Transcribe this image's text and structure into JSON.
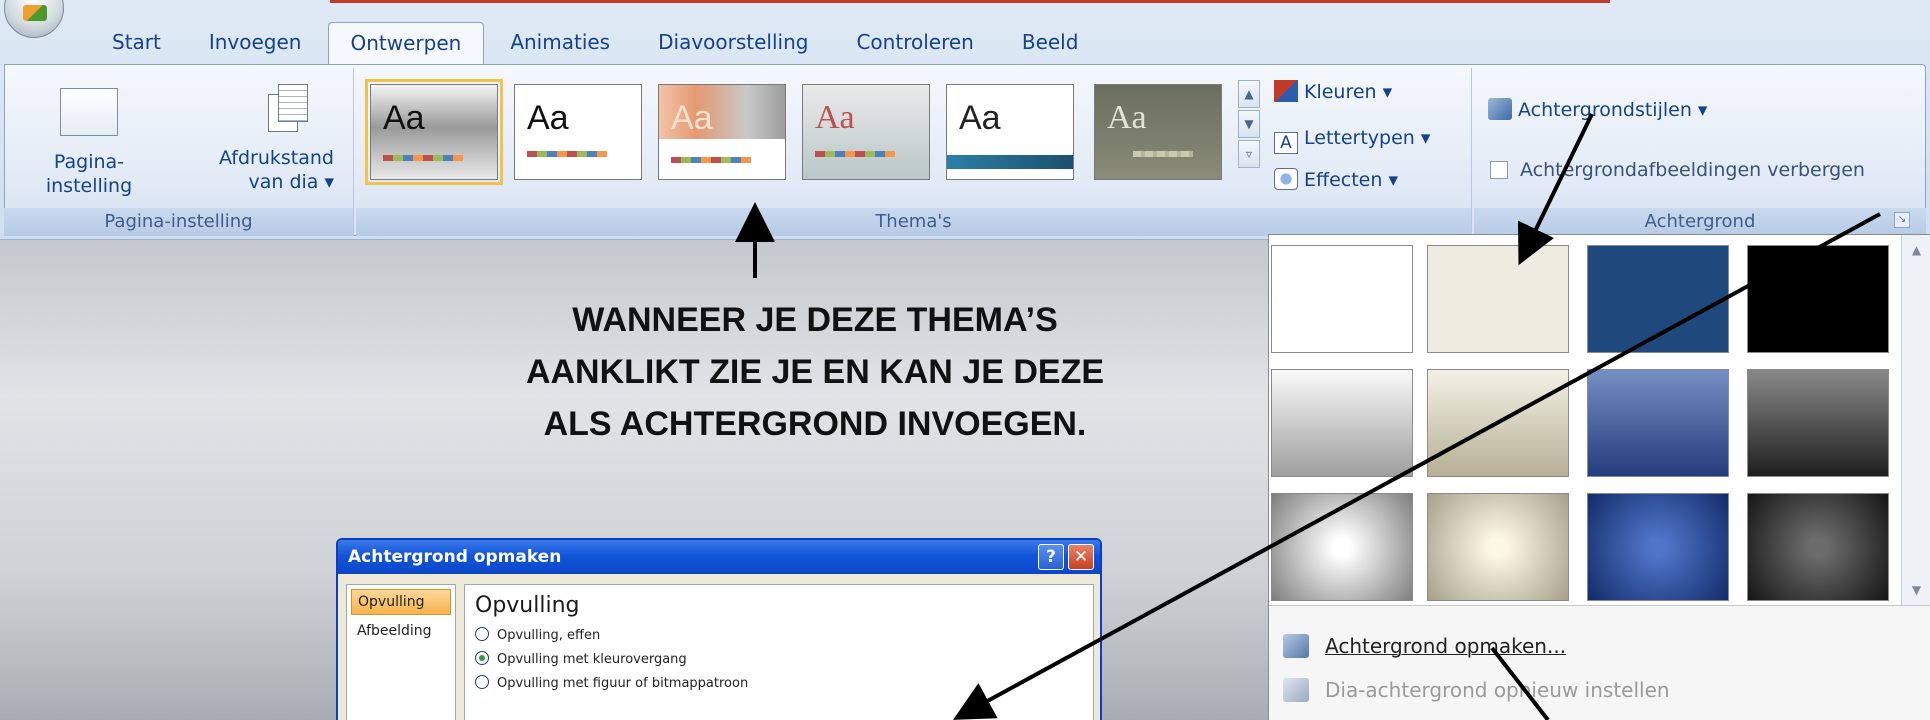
{
  "tabs": [
    "Start",
    "Invoegen",
    "Ontwerpen",
    "Animaties",
    "Diavoorstelling",
    "Controleren",
    "Beeld"
  ],
  "active_tab": "Ontwerpen",
  "page_setup": {
    "page_button": "Pagina-instelling",
    "orientation_line1": "Afdrukstand",
    "orientation_line2": "van dia ▾",
    "group_label": "Pagina-instelling"
  },
  "themes": {
    "sample": "Aa",
    "group_label": "Thema's",
    "colors_label": "Kleuren ▾",
    "fonts_label": "Lettertypen ▾",
    "effects_label": "Effecten ▾"
  },
  "background": {
    "styles_label": "Achtergrondstijlen ▾",
    "hide_label": "Achtergrondafbeeldingen verbergen",
    "group_label": "Achtergrond"
  },
  "callout": {
    "line1": "WANNEER JE DEZE THEMA’S",
    "line2": "AANKLIKT ZIE JE EN KAN JE DEZE",
    "line3": "ALS ACHTERGROND INVOEGEN."
  },
  "gallery_menu": {
    "format": "Achtergrond opmaken...",
    "reset": "Dia-achtergrond opnieuw instellen"
  },
  "dialog": {
    "title": "Achtergrond opmaken",
    "nav": [
      "Opvulling",
      "Afbeelding"
    ],
    "heading": "Opvulling",
    "options": [
      "Opvulling, effen",
      "Opvulling met kleurovergang",
      "Opvulling met figuur of bitmappatroon"
    ],
    "selected_option": 1
  },
  "colors": {
    "ribbon_text": "#15428b",
    "highlight": "#f2c24a",
    "dialog_title": "#1255d9"
  }
}
